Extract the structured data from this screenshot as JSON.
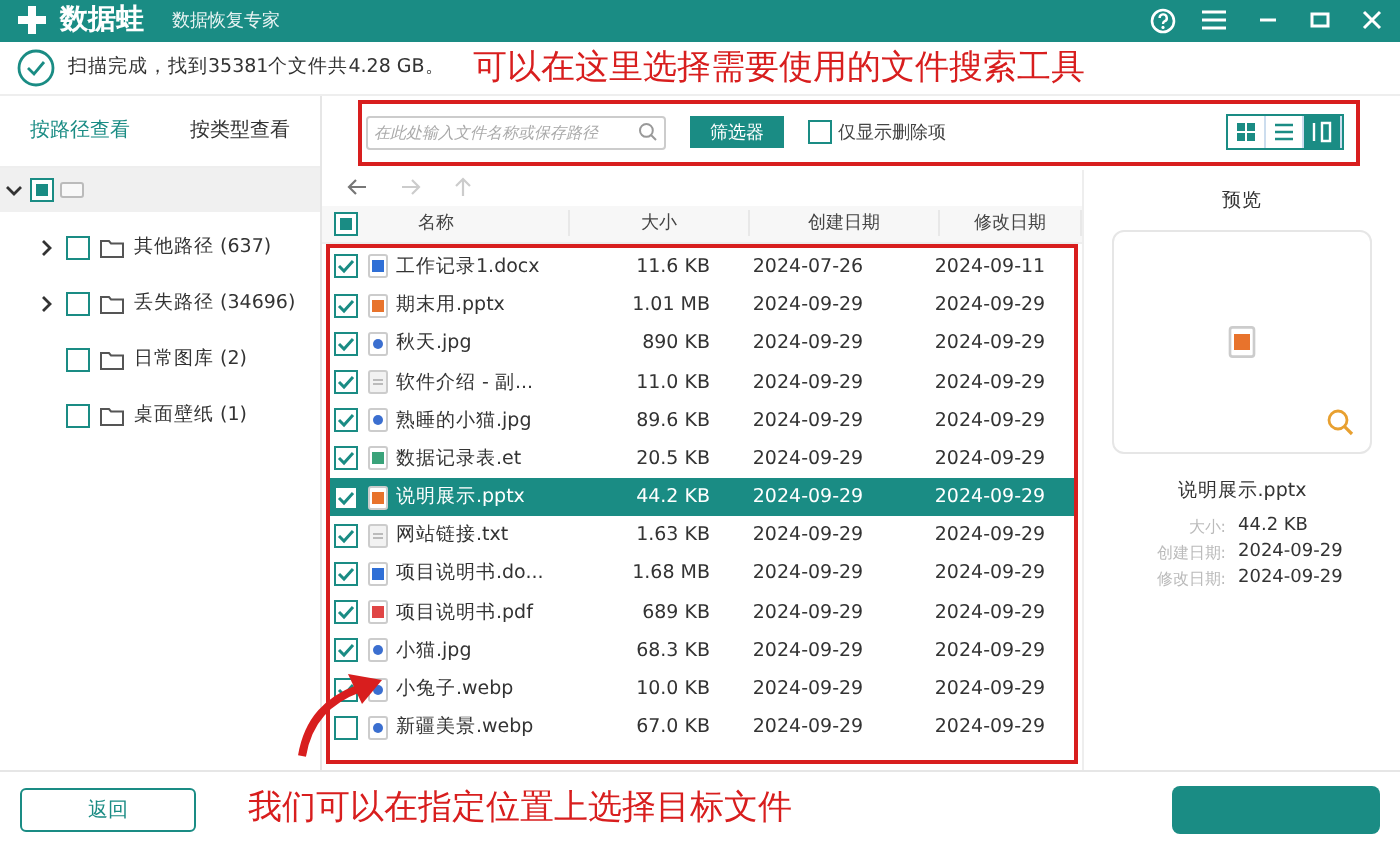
{
  "header": {
    "logo": "数据蛙",
    "subtitle": "数据恢复专家"
  },
  "status": "扫描完成，找到35381个文件共4.28 GB。",
  "annotations": [
    "可以在这里选择需要使用的文件搜索工具",
    "我们可以在指定位置上选择目标文件"
  ],
  "view_tabs": [
    {
      "label": "按路径查看",
      "selected": true
    },
    {
      "label": "按类型查看",
      "selected": false
    }
  ],
  "toolbar": {
    "search": {
      "placeholder": "在此处输入文件名称或保存路径"
    },
    "filter_button": "筛选器",
    "deleted_only": {
      "label": "仅显示删除项",
      "checked": false
    },
    "view_modes": [
      {
        "kind": "grid",
        "selected": false
      },
      {
        "kind": "list",
        "selected": false
      },
      {
        "kind": "detail",
        "selected": true
      }
    ]
  },
  "tree": {
    "checked": false,
    "partial": true,
    "expanded": true,
    "children": [
      {
        "label": "其他路径 (637)",
        "checked": false,
        "expanded": false
      },
      {
        "label": "丢失路径 (34696)",
        "checked": false,
        "expanded": false
      },
      {
        "label": "日常图库 (2)",
        "checked": false
      },
      {
        "label": "桌面壁纸 (1)",
        "checked": false
      }
    ]
  },
  "table": {
    "select_all": {
      "checked": false,
      "partial": true
    },
    "columns": [
      "名称",
      "大小",
      "创建日期",
      "修改日期"
    ],
    "rows": [
      {
        "kind": "doc",
        "checked": true,
        "selected": false,
        "name": "工作记录1.docx",
        "size": "11.6 KB",
        "created": "2024-07-26",
        "modified": "2024-09-11"
      },
      {
        "kind": "ppt",
        "checked": true,
        "selected": false,
        "name": "期末用.pptx",
        "size": "1.01 MB",
        "created": "2024-09-29",
        "modified": "2024-09-29"
      },
      {
        "kind": "image",
        "checked": true,
        "selected": false,
        "name": "秋天.jpg",
        "size": "890 KB",
        "created": "2024-09-29",
        "modified": "2024-09-29"
      },
      {
        "kind": "file",
        "checked": true,
        "selected": false,
        "name": "软件介绍 - 副...",
        "size": "11.0 KB",
        "created": "2024-09-29",
        "modified": "2024-09-29"
      },
      {
        "kind": "image",
        "checked": true,
        "selected": false,
        "name": "熟睡的小猫.jpg",
        "size": "89.6 KB",
        "created": "2024-09-29",
        "modified": "2024-09-29"
      },
      {
        "kind": "sheet",
        "checked": true,
        "selected": false,
        "name": "数据记录表.et",
        "size": "20.5 KB",
        "created": "2024-09-29",
        "modified": "2024-09-29"
      },
      {
        "kind": "ppt",
        "checked": true,
        "selected": true,
        "name": "说明展示.pptx",
        "size": "44.2 KB",
        "created": "2024-09-29",
        "modified": "2024-09-29"
      },
      {
        "kind": "text",
        "checked": true,
        "selected": false,
        "name": "网站链接.txt",
        "size": "1.63 KB",
        "created": "2024-09-29",
        "modified": "2024-09-29"
      },
      {
        "kind": "doc",
        "checked": true,
        "selected": false,
        "name": "项目说明书.do...",
        "size": "1.68 MB",
        "created": "2024-09-29",
        "modified": "2024-09-29"
      },
      {
        "kind": "pdf",
        "checked": true,
        "selected": false,
        "name": "项目说明书.pdf",
        "size": "689 KB",
        "created": "2024-09-29",
        "modified": "2024-09-29"
      },
      {
        "kind": "image",
        "checked": true,
        "selected": false,
        "name": "小猫.jpg",
        "size": "68.3 KB",
        "created": "2024-09-29",
        "modified": "2024-09-29"
      },
      {
        "kind": "image",
        "checked": true,
        "selected": false,
        "name": "小兔子.webp",
        "size": "10.0 KB",
        "created": "2024-09-29",
        "modified": "2024-09-29"
      },
      {
        "kind": "image",
        "checked": false,
        "selected": false,
        "name": "新疆美景.webp",
        "size": "67.0 KB",
        "created": "2024-09-29",
        "modified": "2024-09-29"
      }
    ]
  },
  "preview": {
    "title": "预览",
    "kind": "ppt",
    "filename": "说明展示.pptx",
    "details": [
      {
        "label": "大小:",
        "value": "44.2 KB"
      },
      {
        "label": "创建日期:",
        "value": "2024-09-29"
      },
      {
        "label": "修改日期:",
        "value": "2024-09-29"
      }
    ]
  },
  "footer": {
    "back_button": "返回"
  }
}
